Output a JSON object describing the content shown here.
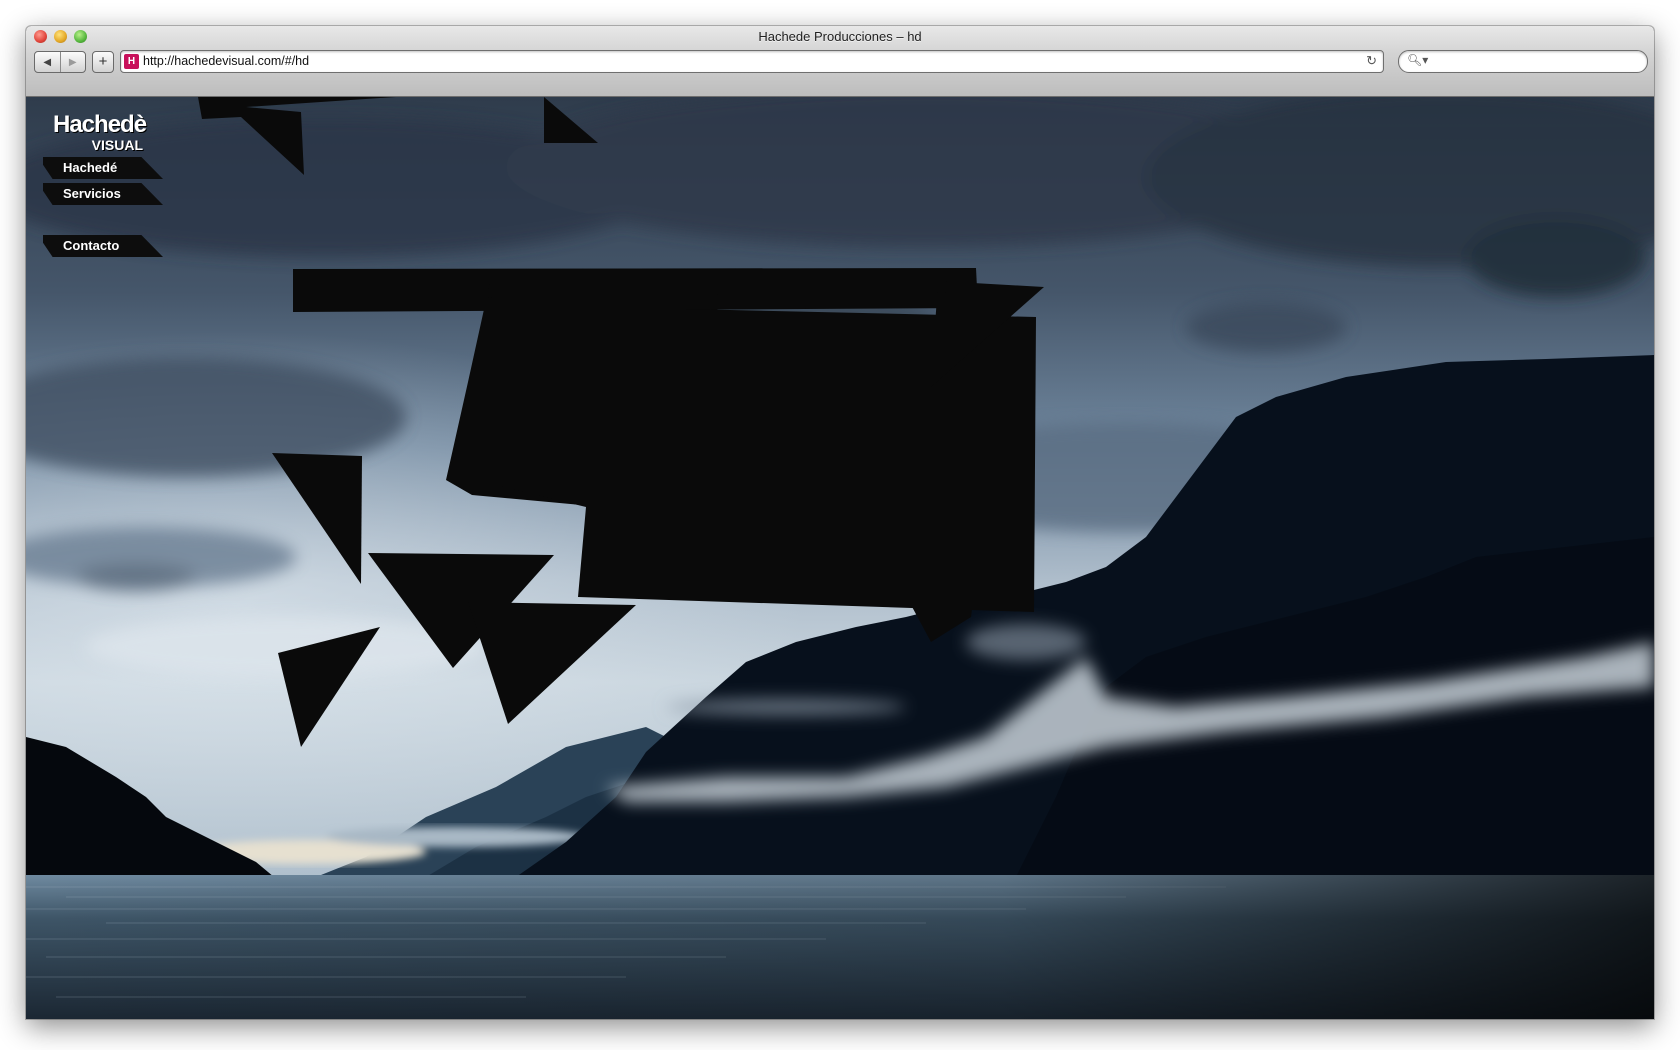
{
  "window": {
    "title": "Hachede Producciones – hd"
  },
  "toolbar": {
    "back_icon": "◀",
    "forward_icon": "▶",
    "add_icon": "+",
    "url": "http://hachedevisual.com/#/hd",
    "favicon_text": "H",
    "reload_icon": "↻",
    "search_icon": "🔍︎▾",
    "search_value": ""
  },
  "site": {
    "logo_line1": "Hachedè",
    "logo_line2": "VISUAL",
    "nav": [
      {
        "label": "Hachedé"
      },
      {
        "label": "Servicios"
      },
      {
        "label": "Contacto"
      }
    ]
  },
  "colors": {
    "sky": "#6f8aa6",
    "mountains": "#050912",
    "water": "#2c4156",
    "shapes": "#0a0a0a",
    "favicon": "#c8105a"
  }
}
